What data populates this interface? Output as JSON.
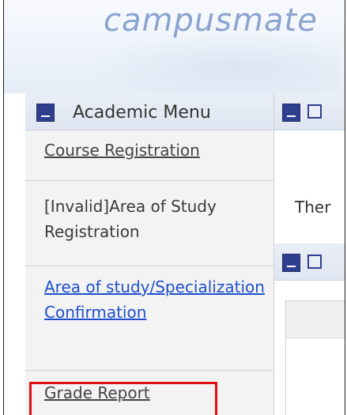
{
  "brand": {
    "logo_text": "campusmate"
  },
  "sidebar": {
    "title": "Academic Menu",
    "items": [
      {
        "label": "Course Registration",
        "style": "link-gray"
      },
      {
        "label": "[Invalid]Area of Study Registration",
        "style": "plain"
      },
      {
        "label": "Area of study/Specialization Confirmation",
        "style": "link"
      },
      {
        "label": "Grade Report",
        "style": "link-gray",
        "highlighted": true
      }
    ]
  },
  "content": {
    "panel_text": "Ther"
  },
  "colors": {
    "accent": "#2f3f8f",
    "highlight": "#e01010",
    "link": "#1f4fcc"
  }
}
